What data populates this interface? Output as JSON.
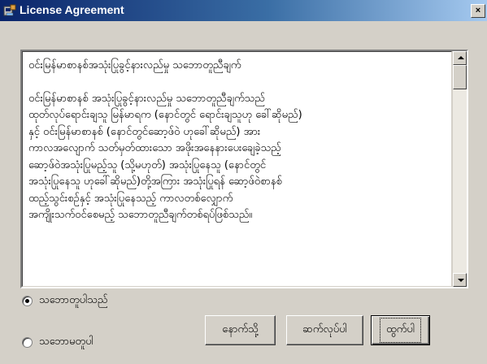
{
  "window": {
    "title": "License Agreement",
    "close_label": "×",
    "icons": {
      "app": "setup-icon",
      "close": "close-icon"
    }
  },
  "agreement": {
    "heading": "ဝင်းမြန်မာစာနစ်အသုံးပြုခွင့်နားလည်မှု သဘောတူညီချက်",
    "lines": [
      "ဝင်းမြန်မာစာနစ် အသုံးပြုခွင့်နားလည်မှု သဘောတူညီချက်သည်",
      "ထုတ်လုပ်ရောင်းချသူ  မြန်မာရက (နောင်တွင် ရောင်းချသူဟု ခေါ်ဆိုမည်)",
      "နှင့် ဝင်းမြန်မာစာနစ် (နောင်တွင်ဆော့ဖ်ဝဲ ဟုခေါ်ဆိုမည်) အား",
      "ကာလအလျောက် သတ်မှတ်ထားသော အဖိုးအနေနားပေးချေခဲ့သည့်",
      "ဆော့ဖ်ဝဲအသုံးပြုမည့်သူ (သို့မဟုတ်) အသုံးပြုနေသူ (နောင်တွင်",
      "အသုံးပြုနေသူ ဟုခေါ်ဆိုမည်)တို့အကြား အသုံးပြုရန် ဆော့ဖ်ဝဲစာနစ်",
      "ထည့်သွင်းစဉ်နှင့် အသုံးပြုနေသည့် ကာလတစ်လျှောက်",
      "အကျိုးသက်ဝင်စေမည့် သဘောတူညီချက်တစ်ရပ်ဖြစ်သည်။"
    ]
  },
  "options": {
    "accept_label": "သဘောတူပါသည်",
    "decline_label": "သဘောမတူပါ",
    "selected": "accept"
  },
  "buttons": {
    "back": "နောက်သို့",
    "next": "ဆက်လုပ်ပါ",
    "cancel": "ထွက်ပါ"
  }
}
